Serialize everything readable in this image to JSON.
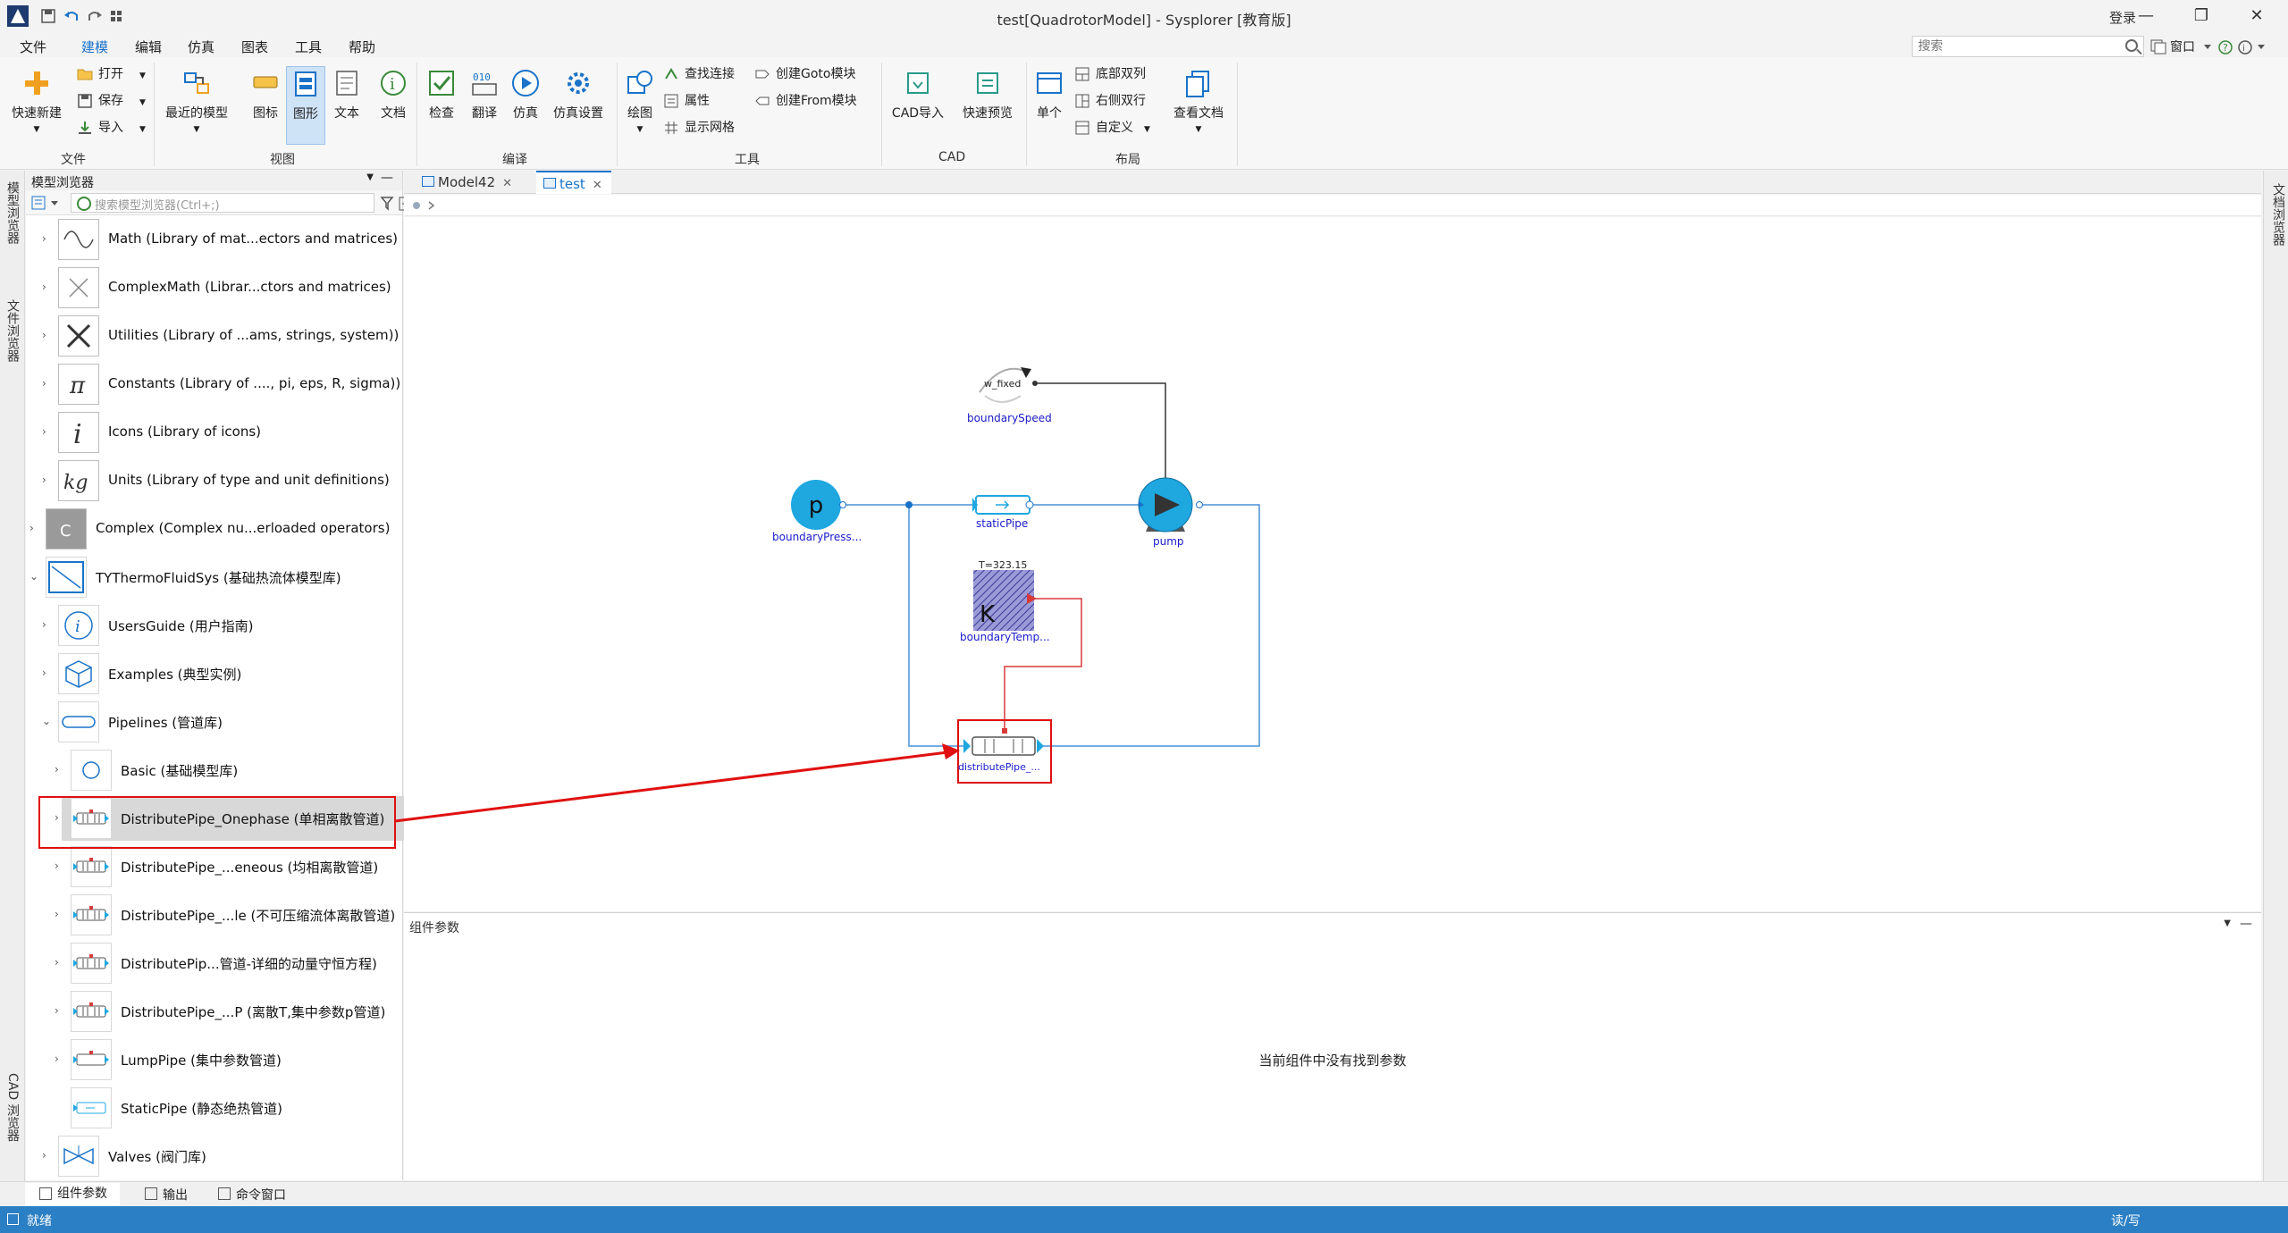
{
  "window": {
    "title": "test[QuadrotorModel] - Sysplorer [教育版]",
    "login": "登录",
    "minimize": "—",
    "restore": "❐",
    "close": "✕"
  },
  "menu": [
    "文件",
    "建模",
    "编辑",
    "仿真",
    "图表",
    "工具",
    "帮助"
  ],
  "search": {
    "placeholder": "搜索"
  },
  "window_menu": "窗口",
  "ribbon": {
    "file": {
      "new": "快速新建",
      "open": "打开",
      "save": "保存",
      "import": "导入",
      "group": "文件"
    },
    "view": {
      "recent": "最近的模型",
      "icon": "图标",
      "diagram": "图形",
      "text": "文本",
      "doc": "文档",
      "group": "视图"
    },
    "compile": {
      "check": "检查",
      "translate": "翻译",
      "simulate": "仿真",
      "sim_setup": "仿真设置",
      "group": "编译"
    },
    "tools": {
      "draw": "绘图",
      "find_conn": "查找连接",
      "props": "属性",
      "grid": "显示网格",
      "goto": "创建Goto模块",
      "from": "创建From模块",
      "group": "工具"
    },
    "cad": {
      "import": "CAD导入",
      "preview": "快速预览",
      "group": "CAD"
    },
    "layout": {
      "single": "单个",
      "bottom_dual": "底部双列",
      "right_dual": "右侧双行",
      "custom": "自定义",
      "view_doc": "查看文档",
      "group": "布局"
    }
  },
  "side_tabs": {
    "model_browser": "模型浏览器",
    "file_browser": "文件浏览器",
    "cad_browser": "CAD 浏览器",
    "doc_browser": "文档浏览器"
  },
  "browser": {
    "title": "模型浏览器",
    "search_placeholder": "搜索模型浏览器(Ctrl+;)",
    "items": [
      {
        "label": "Math (Library of mat...ectors and matrices)",
        "glyph": "∿"
      },
      {
        "label": "ComplexMath (Librar...ctors and matrices)",
        "glyph": "✕"
      },
      {
        "label": "Utilities (Library of ...ams, strings, system))",
        "glyph": "✂"
      },
      {
        "label": "Constants (Library of ...., pi, eps, R, sigma))",
        "glyph": "π"
      },
      {
        "label": "Icons (Library of icons)",
        "glyph": "i"
      },
      {
        "label": "Units (Library of type and unit definitions)",
        "glyph": "kg"
      },
      {
        "label": "Complex (Complex nu...erloaded operators)",
        "glyph": "C"
      },
      {
        "label": "TYThermoFluidSys (基础热流体模型库)",
        "glyph": ""
      },
      {
        "label": "UsersGuide (用户指南)",
        "glyph": "i"
      },
      {
        "label": "Examples (典型实例)",
        "glyph": ""
      },
      {
        "label": "Pipelines (管道库)",
        "glyph": ""
      },
      {
        "label": "Basic (基础模型库)",
        "glyph": ""
      },
      {
        "label": "DistributePipe_Onephase (单相离散管道)",
        "glyph": ""
      },
      {
        "label": "DistributePipe_...eneous (均相离散管道)",
        "glyph": ""
      },
      {
        "label": "DistributePipe_...le (不可压缩流体离散管道)",
        "glyph": ""
      },
      {
        "label": "DistributePip...管道-详细的动量守恒方程)",
        "glyph": ""
      },
      {
        "label": "DistributePipe_...P (离散T,集中参数p管道)",
        "glyph": ""
      },
      {
        "label": "LumpPipe (集中参数管道)",
        "glyph": ""
      },
      {
        "label": "StaticPipe (静态绝热管道)",
        "glyph": ""
      },
      {
        "label": "Valves (阀门库)",
        "glyph": ""
      }
    ]
  },
  "doc_tabs": [
    {
      "label": "Model42",
      "close": "✕"
    },
    {
      "label": "test",
      "close": "✕"
    }
  ],
  "diagram": {
    "components": {
      "boundary_speed": {
        "label": "boundarySpeed",
        "param": "w_fixed"
      },
      "boundary_pressure": {
        "label": "boundaryPress...",
        "glyph": "p"
      },
      "static_pipe": {
        "label": "staticPipe"
      },
      "pump": {
        "label": "pump"
      },
      "boundary_temp": {
        "label": "boundaryTemp...",
        "param": "T=323.15",
        "glyph": "K"
      },
      "distribute_pipe": {
        "label": "distributePipe_..."
      }
    },
    "colors": {
      "connection": "#4a90d9",
      "signal": "#d83a3a",
      "label": "#1a1ac9",
      "highlight": "#e01010"
    }
  },
  "params": {
    "title": "组件参数",
    "empty_text": "当前组件中没有找到参数"
  },
  "bottom_tabs": [
    "组件参数",
    "输出",
    "命令窗口"
  ],
  "status": {
    "left": "就绪",
    "right": "读/写"
  }
}
